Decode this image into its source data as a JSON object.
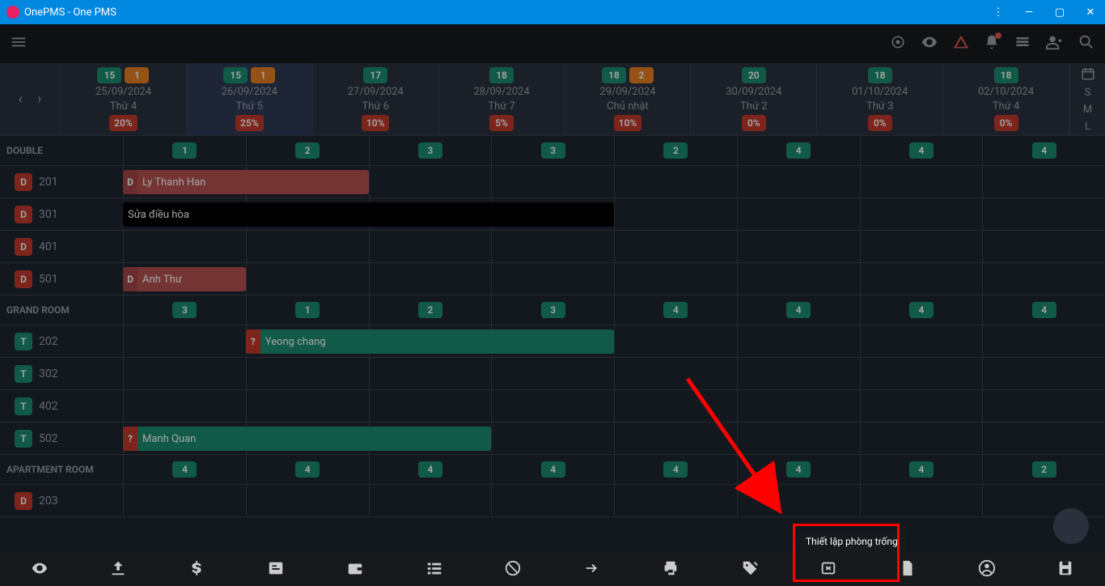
{
  "titlebar": {
    "title": "OnePMS - One PMS"
  },
  "dates": [
    {
      "day": "15",
      "extra": "1",
      "date": "25/09/2024",
      "weekday": "Thứ 4",
      "pct": "20%",
      "active": false
    },
    {
      "day": "15",
      "extra": "1",
      "date": "26/09/2024",
      "weekday": "Thứ 5",
      "pct": "25%",
      "active": true
    },
    {
      "day": "17",
      "extra": "",
      "date": "27/09/2024",
      "weekday": "Thứ 6",
      "pct": "10%",
      "active": false
    },
    {
      "day": "18",
      "extra": "",
      "date": "28/09/2024",
      "weekday": "Thứ 7",
      "pct": "5%",
      "active": false
    },
    {
      "day": "18",
      "extra": "2",
      "date": "29/09/2024",
      "weekday": "Chủ nhật",
      "pct": "10%",
      "active": false
    },
    {
      "day": "20",
      "extra": "",
      "date": "30/09/2024",
      "weekday": "Thứ 2",
      "pct": "0%",
      "active": false
    },
    {
      "day": "18",
      "extra": "",
      "date": "01/10/2024",
      "weekday": "Thứ 3",
      "pct": "0%",
      "active": false
    },
    {
      "day": "18",
      "extra": "",
      "date": "02/10/2024",
      "weekday": "Thứ 4",
      "pct": "0%",
      "active": false
    }
  ],
  "sidecol": {
    "s": "S",
    "m": "M",
    "l": "L"
  },
  "sections": [
    {
      "name": "DOUBLE",
      "counts": [
        "1",
        "2",
        "3",
        "3",
        "2",
        "4",
        "4",
        "4"
      ],
      "rooms": [
        {
          "tag": "D",
          "tagClass": "tag-d",
          "num": "201",
          "bookings": [
            {
              "cls": "bk-red",
              "status": "D",
              "name": "Ly Thanh Han",
              "left": 0,
              "width": 25
            }
          ]
        },
        {
          "tag": "D",
          "tagClass": "tag-d",
          "num": "301",
          "bookings": [
            {
              "cls": "bk-black",
              "status": "",
              "name": "Sửa điều hòa",
              "left": 0,
              "width": 50
            }
          ]
        },
        {
          "tag": "D",
          "tagClass": "tag-d",
          "num": "401",
          "bookings": []
        },
        {
          "tag": "D",
          "tagClass": "tag-d",
          "num": "501",
          "bookings": [
            {
              "cls": "bk-red",
              "status": "D",
              "name": "Anh Thư",
              "left": 0,
              "width": 12.5
            }
          ]
        }
      ]
    },
    {
      "name": "GRAND ROOM",
      "counts": [
        "3",
        "1",
        "2",
        "3",
        "4",
        "4",
        "4",
        "4"
      ],
      "rooms": [
        {
          "tag": "T",
          "tagClass": "tag-t",
          "num": "202",
          "bookings": [
            {
              "cls": "bk-teal",
              "status": "?",
              "name": "Yeong chang",
              "left": 12.5,
              "width": 37.5
            }
          ]
        },
        {
          "tag": "T",
          "tagClass": "tag-t",
          "num": "302",
          "bookings": []
        },
        {
          "tag": "T",
          "tagClass": "tag-t",
          "num": "402",
          "bookings": []
        },
        {
          "tag": "T",
          "tagClass": "tag-t",
          "num": "502",
          "bookings": [
            {
              "cls": "bk-teal",
              "status": "?",
              "name": "Manh Quan",
              "left": 0,
              "width": 37.5
            }
          ]
        }
      ]
    },
    {
      "name": "APARTMENT ROOM",
      "counts": [
        "4",
        "4",
        "4",
        "4",
        "4",
        "4",
        "4",
        "2"
      ],
      "rooms": [
        {
          "tag": "D",
          "tagClass": "tag-d",
          "num": "203",
          "bookings": []
        }
      ]
    }
  ],
  "tooltip": {
    "text": "Thiết lập phòng trống"
  },
  "bottombar_icons": [
    "eye",
    "download",
    "dollar",
    "note",
    "wallet",
    "list",
    "block",
    "arrow",
    "print",
    "tag",
    "cancel",
    "file",
    "account",
    "save"
  ]
}
